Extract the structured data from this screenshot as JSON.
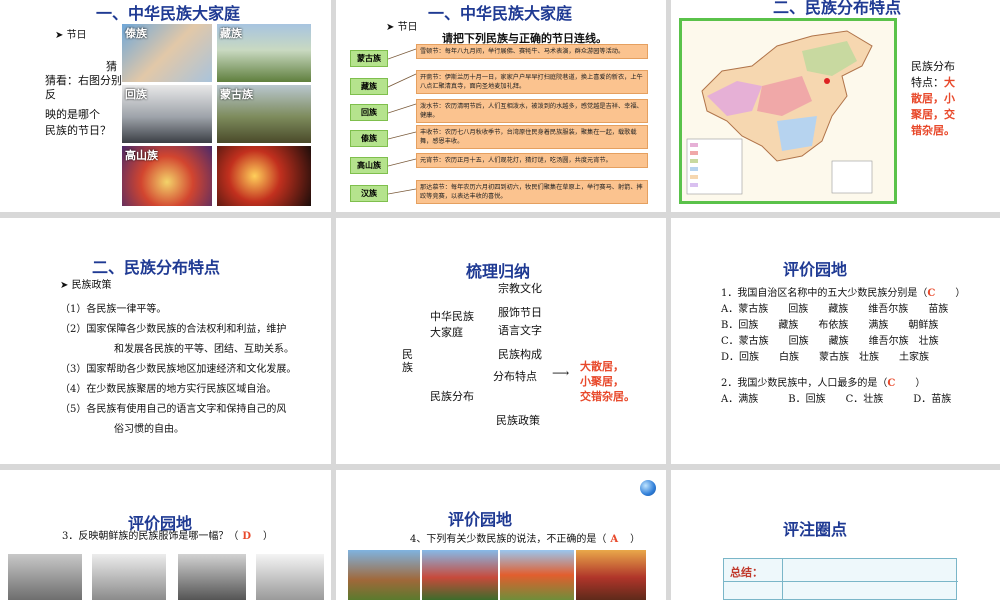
{
  "s1": {
    "title": "一、中华民族大家庭",
    "bullet": "节日",
    "q1": "猜",
    "q2": "猜看：右图分别反",
    "q3": "映的是哪个",
    "q4": "民族的节日？",
    "photos": [
      "傣族",
      "藏族",
      "回族",
      "蒙古族",
      "高山族",
      ""
    ]
  },
  "s2": {
    "title": "一、中华民族大家庭",
    "bullet": "节日",
    "instruction": "请把下列民族与正确的节日连线。",
    "ethnic": [
      "蒙古族",
      "藏族",
      "回族",
      "傣族",
      "高山族",
      "汉族"
    ],
    "festivals": [
      "雪顿节：每年八九月间，举行展佛、赛牦牛、马术表演，群众游园等活动。",
      "开斋节：伊斯兰历十月一日，家家户户早早打扫庭院巷道，换上喜爱的新衣，上午八点汇聚清真寺，面向圣地麦加礼拜。",
      "泼水节：农历清明节后，人们互相泼水，被泼到的水越多，感觉越是吉祥、幸福、健康。",
      "丰收节：农历七八月秋收季节，台湾原住民身着民族服装，聚集在一起，载歌载舞，感恩丰收。",
      "元宵节：农历正月十五，人们观花灯，猜灯谜，吃汤圆，共度元宵节。",
      "那达慕节：每年农历六月初四到初六，牧民们聚集在草原上，举行赛马、射箭、摔跤等竞赛，以表达丰收的喜悦。"
    ]
  },
  "s3": {
    "title": "二、民族分布特点",
    "text1": "民族分布",
    "text2": "特点：",
    "red1": "大",
    "red2": "散居，小",
    "red3": "聚居，交",
    "red4": "错杂居。"
  },
  "s4": {
    "title": "二、民族分布特点",
    "bullet": "民族政策",
    "items": [
      "（1）各民族一律平等。",
      "（2）国家保障各少数民族的合法权利和利益，维护",
      "和发展各民族的平等、团结、互助关系。",
      "（3）国家帮助各少数民族地区加速经济和文化发展。",
      "（4）在少数民族聚居的地方实行民族区域自治。",
      "（5）各民族有使用自己的语言文字和保持自己的风",
      "俗习惯的自由。"
    ]
  },
  "s5": {
    "title": "梳理归纳",
    "root": "民族",
    "branch1a": "中华民族",
    "branch1b": "大家庭",
    "sub1": "宗教文化",
    "sub2": "服饰节日",
    "sub3": "语言文字",
    "sub4": "民族构成",
    "sub5": "分布特点",
    "branch2": "民族分布",
    "sub6": "民族政策",
    "ans1": "大散居，",
    "ans2": "小聚居，",
    "ans3": "交错杂居。"
  },
  "s6": {
    "title": "评价园地",
    "q1": "1．我国自治区名称中的五大少数民族分别是（",
    "q1ans": "C",
    "q1end": "）",
    "q1opts": [
      "A．蒙古族　　回族　　藏族　　维吾尔族　　苗族",
      "B．回族　　藏族　　布依族　　满族　　朝鲜族",
      "C．蒙古族　　回族　　藏族　　维吾尔族　壮族",
      "D．回族　　白族　　蒙古族　壮族　　土家族"
    ],
    "q2": "2．我国少数民族中，人口最多的是（",
    "q2ans": "C",
    "q2end": "）",
    "q2opts": "A．满族　　　B．回族　　C．壮族　　　D．苗族"
  },
  "s7": {
    "title": "评价园地",
    "q3": "3．反映朝鲜族的民族服饰是哪一幅？（",
    "q3ans": "D",
    "q3end": "）"
  },
  "s8": {
    "title": "评价园地",
    "q4": "4、下列有关少数民族的说法，不正确的是（",
    "q4ans": "A",
    "q4end": "）"
  },
  "s9": {
    "title": "评注圈点",
    "summary": "总结："
  },
  "colors": {
    "title": "#1f3a93",
    "answer": "#e8492b",
    "tag": "#b5e38d",
    "festival": "#fbc38f"
  }
}
